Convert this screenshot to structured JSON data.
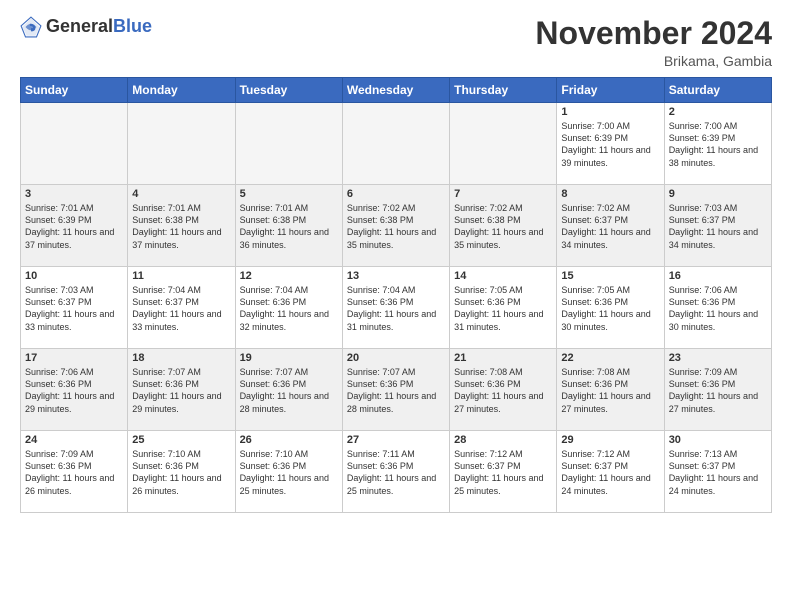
{
  "header": {
    "logo_general": "General",
    "logo_blue": "Blue",
    "month": "November 2024",
    "location": "Brikama, Gambia"
  },
  "weekdays": [
    "Sunday",
    "Monday",
    "Tuesday",
    "Wednesday",
    "Thursday",
    "Friday",
    "Saturday"
  ],
  "weeks": [
    [
      {
        "day": "",
        "info": ""
      },
      {
        "day": "",
        "info": ""
      },
      {
        "day": "",
        "info": ""
      },
      {
        "day": "",
        "info": ""
      },
      {
        "day": "",
        "info": ""
      },
      {
        "day": "1",
        "info": "Sunrise: 7:00 AM\nSunset: 6:39 PM\nDaylight: 11 hours and 39 minutes."
      },
      {
        "day": "2",
        "info": "Sunrise: 7:00 AM\nSunset: 6:39 PM\nDaylight: 11 hours and 38 minutes."
      }
    ],
    [
      {
        "day": "3",
        "info": "Sunrise: 7:01 AM\nSunset: 6:39 PM\nDaylight: 11 hours and 37 minutes."
      },
      {
        "day": "4",
        "info": "Sunrise: 7:01 AM\nSunset: 6:38 PM\nDaylight: 11 hours and 37 minutes."
      },
      {
        "day": "5",
        "info": "Sunrise: 7:01 AM\nSunset: 6:38 PM\nDaylight: 11 hours and 36 minutes."
      },
      {
        "day": "6",
        "info": "Sunrise: 7:02 AM\nSunset: 6:38 PM\nDaylight: 11 hours and 35 minutes."
      },
      {
        "day": "7",
        "info": "Sunrise: 7:02 AM\nSunset: 6:38 PM\nDaylight: 11 hours and 35 minutes."
      },
      {
        "day": "8",
        "info": "Sunrise: 7:02 AM\nSunset: 6:37 PM\nDaylight: 11 hours and 34 minutes."
      },
      {
        "day": "9",
        "info": "Sunrise: 7:03 AM\nSunset: 6:37 PM\nDaylight: 11 hours and 34 minutes."
      }
    ],
    [
      {
        "day": "10",
        "info": "Sunrise: 7:03 AM\nSunset: 6:37 PM\nDaylight: 11 hours and 33 minutes."
      },
      {
        "day": "11",
        "info": "Sunrise: 7:04 AM\nSunset: 6:37 PM\nDaylight: 11 hours and 33 minutes."
      },
      {
        "day": "12",
        "info": "Sunrise: 7:04 AM\nSunset: 6:36 PM\nDaylight: 11 hours and 32 minutes."
      },
      {
        "day": "13",
        "info": "Sunrise: 7:04 AM\nSunset: 6:36 PM\nDaylight: 11 hours and 31 minutes."
      },
      {
        "day": "14",
        "info": "Sunrise: 7:05 AM\nSunset: 6:36 PM\nDaylight: 11 hours and 31 minutes."
      },
      {
        "day": "15",
        "info": "Sunrise: 7:05 AM\nSunset: 6:36 PM\nDaylight: 11 hours and 30 minutes."
      },
      {
        "day": "16",
        "info": "Sunrise: 7:06 AM\nSunset: 6:36 PM\nDaylight: 11 hours and 30 minutes."
      }
    ],
    [
      {
        "day": "17",
        "info": "Sunrise: 7:06 AM\nSunset: 6:36 PM\nDaylight: 11 hours and 29 minutes."
      },
      {
        "day": "18",
        "info": "Sunrise: 7:07 AM\nSunset: 6:36 PM\nDaylight: 11 hours and 29 minutes."
      },
      {
        "day": "19",
        "info": "Sunrise: 7:07 AM\nSunset: 6:36 PM\nDaylight: 11 hours and 28 minutes."
      },
      {
        "day": "20",
        "info": "Sunrise: 7:07 AM\nSunset: 6:36 PM\nDaylight: 11 hours and 28 minutes."
      },
      {
        "day": "21",
        "info": "Sunrise: 7:08 AM\nSunset: 6:36 PM\nDaylight: 11 hours and 27 minutes."
      },
      {
        "day": "22",
        "info": "Sunrise: 7:08 AM\nSunset: 6:36 PM\nDaylight: 11 hours and 27 minutes."
      },
      {
        "day": "23",
        "info": "Sunrise: 7:09 AM\nSunset: 6:36 PM\nDaylight: 11 hours and 27 minutes."
      }
    ],
    [
      {
        "day": "24",
        "info": "Sunrise: 7:09 AM\nSunset: 6:36 PM\nDaylight: 11 hours and 26 minutes."
      },
      {
        "day": "25",
        "info": "Sunrise: 7:10 AM\nSunset: 6:36 PM\nDaylight: 11 hours and 26 minutes."
      },
      {
        "day": "26",
        "info": "Sunrise: 7:10 AM\nSunset: 6:36 PM\nDaylight: 11 hours and 25 minutes."
      },
      {
        "day": "27",
        "info": "Sunrise: 7:11 AM\nSunset: 6:36 PM\nDaylight: 11 hours and 25 minutes."
      },
      {
        "day": "28",
        "info": "Sunrise: 7:12 AM\nSunset: 6:37 PM\nDaylight: 11 hours and 25 minutes."
      },
      {
        "day": "29",
        "info": "Sunrise: 7:12 AM\nSunset: 6:37 PM\nDaylight: 11 hours and 24 minutes."
      },
      {
        "day": "30",
        "info": "Sunrise: 7:13 AM\nSunset: 6:37 PM\nDaylight: 11 hours and 24 minutes."
      }
    ]
  ]
}
